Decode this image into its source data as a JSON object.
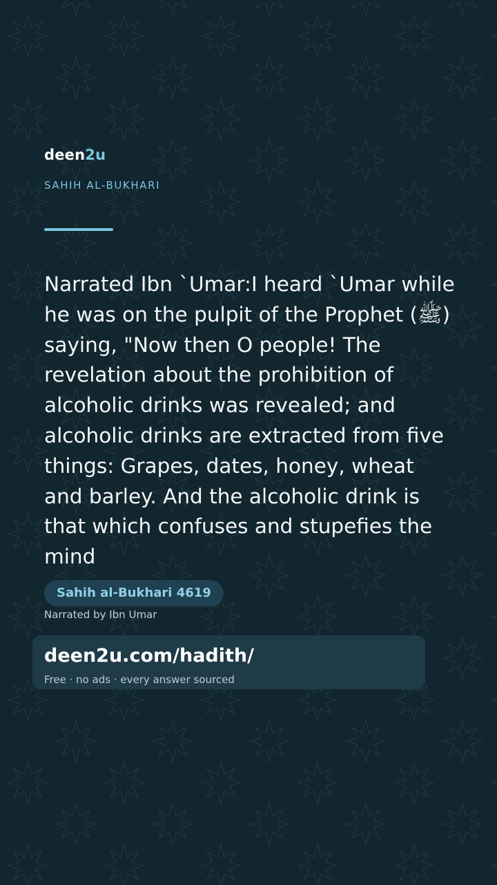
{
  "brand": {
    "name": "deen",
    "suffix": "2u"
  },
  "collection_label": "SAHIH AL-BUKHARI",
  "hadith": {
    "text": "Narrated Ibn `Umar:I heard `Umar while he was on the pulpit of the Prophet (ﷺ) saying, \"Now then O people! The revelation about the prohibition of alcoholic drinks was revealed; and alcoholic drinks are extracted from five things: Grapes, dates, honey, wheat and barley. And the alcoholic drink is that which confuses and stupefies the mind",
    "reference": "Sahih al-Bukhari 4619",
    "narrator": "Narrated by Ibn Umar"
  },
  "cta": {
    "url": "deen2u.com/hadith/",
    "tagline": "Free · no ads · every answer sourced"
  },
  "colors": {
    "background": "#12262f",
    "accent": "#7cc6e0",
    "badge_background": "#1f4151",
    "card_background": "#1f3b47",
    "text": "#f3f6f7"
  },
  "icons": {
    "background_pattern": "eight-point-star-pattern"
  }
}
